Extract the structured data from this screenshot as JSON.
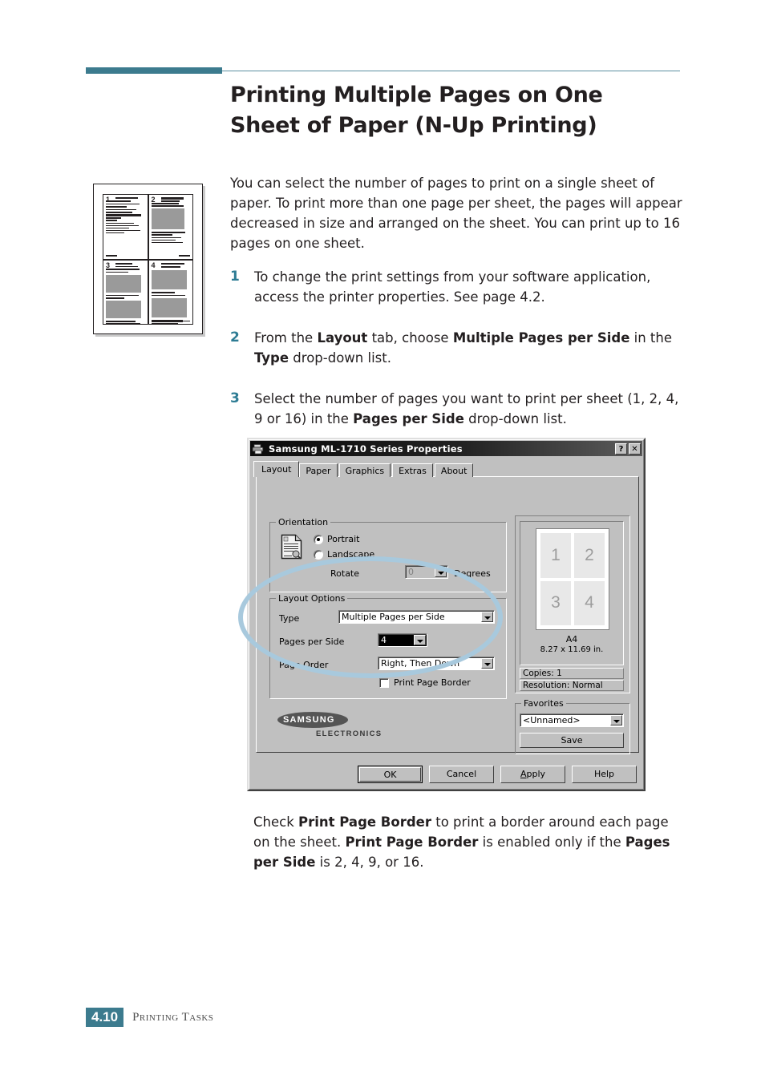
{
  "page": {
    "title_line1": "Printing Multiple Pages on One",
    "title_line2": "Sheet of Paper (N-Up Printing)",
    "accent_color": "#3c7b8e",
    "intro": "You can select the number of pages to print on a single sheet of paper. To print more than one page per sheet, the pages will appear decreased in size and arranged on the sheet. You can print up to 16 pages on one sheet.",
    "footer_page": "4.10",
    "footer_section": "Printing Tasks"
  },
  "illustration": {
    "page_numbers": [
      "1",
      "2",
      "3",
      "4"
    ]
  },
  "steps": [
    {
      "num": "1",
      "text": "To change the print settings from your software application, access the printer properties. See page 4.2."
    },
    {
      "num": "2",
      "text_parts": [
        "From the ",
        "Layout",
        " tab, choose ",
        "Multiple Pages per Side",
        " in the ",
        "Type",
        " drop-down list."
      ]
    },
    {
      "num": "3",
      "text_parts": [
        "Select the number of pages you want to print per sheet (1, 2, 4, 9 or 16) in the ",
        "Pages per Side",
        " drop-down list."
      ]
    }
  ],
  "closing": {
    "parts": [
      "Check ",
      "Print Page Border",
      " to print a border around each page on the sheet. ",
      "Print Page Border",
      " is enabled only if the ",
      "Pages per Side",
      " is 2, 4, 9, or 16."
    ]
  },
  "dialog": {
    "title": "Samsung ML-1710 Series Properties",
    "titlebar_icon": "printer-icon",
    "help_button": "?",
    "close_button": "✕",
    "tabs": [
      {
        "label": "Layout",
        "active": true
      },
      {
        "label": "Paper",
        "active": false
      },
      {
        "label": "Graphics",
        "active": false
      },
      {
        "label": "Extras",
        "active": false
      },
      {
        "label": "About",
        "active": false
      }
    ],
    "orientation": {
      "group_label": "Orientation",
      "options": [
        {
          "label": "Portrait",
          "checked": true
        },
        {
          "label": "Landscape",
          "checked": false
        }
      ],
      "rotate_label": "Rotate",
      "rotate_value": "0",
      "degrees_label": "Degrees"
    },
    "layout_options": {
      "group_label": "Layout Options",
      "type_label": "Type",
      "type_value": "Multiple Pages per Side",
      "pages_per_side_label": "Pages per Side",
      "pages_per_side_value": "4",
      "page_order_label": "Page Order",
      "page_order_value": "Right, Then Down",
      "print_page_border_label": "Print Page Border",
      "print_page_border_checked": false
    },
    "preview": {
      "cells": [
        "1",
        "2",
        "3",
        "4"
      ],
      "paper_name": "A4",
      "paper_size": "8.27 x 11.69 in.",
      "copies": "Copies: 1",
      "resolution": "Resolution: Normal"
    },
    "favorites": {
      "group_label": "Favorites",
      "selected": "<Unnamed>",
      "save_label": "Save"
    },
    "logo": {
      "brand": "SAMSUNG",
      "sub": "ELECTRONICS"
    },
    "buttons": [
      {
        "label": "OK",
        "default": true
      },
      {
        "label": "Cancel",
        "default": false
      },
      {
        "label": "Apply",
        "default": false,
        "accel": "A"
      },
      {
        "label": "Help",
        "default": false
      }
    ]
  },
  "annotation": {
    "highlight_color": "#a8c9dd",
    "target": "layout-options-group"
  }
}
